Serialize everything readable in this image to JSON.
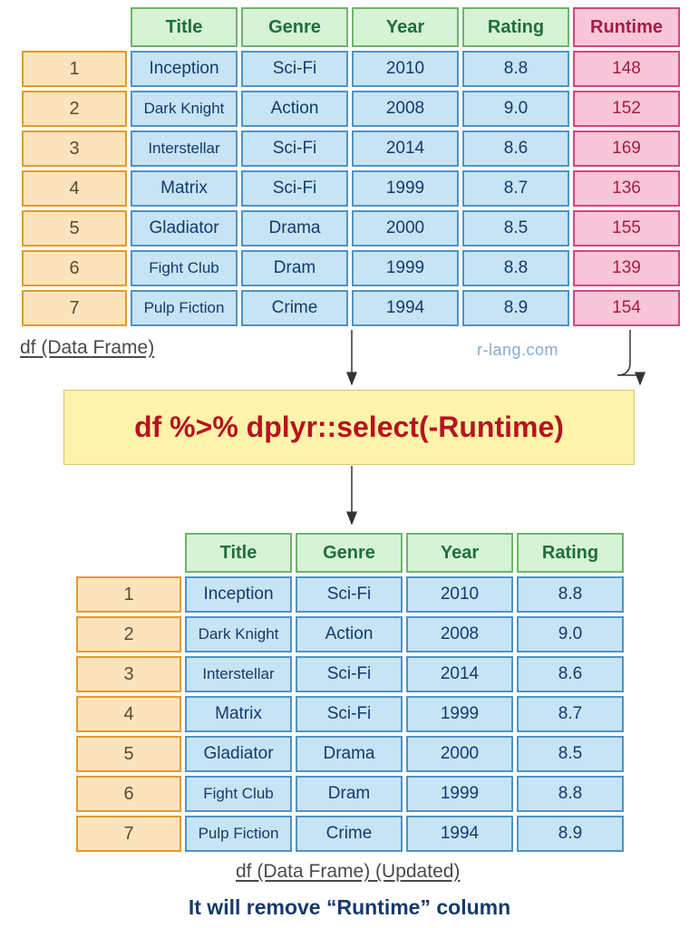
{
  "columns": [
    "Title",
    "Genre",
    "Year",
    "Rating",
    "Runtime"
  ],
  "highlight_column": "Runtime",
  "rows": [
    {
      "idx": "1",
      "Title": "Inception",
      "Genre": "Sci-Fi",
      "Year": "2010",
      "Rating": "8.8",
      "Runtime": "148"
    },
    {
      "idx": "2",
      "Title": "Dark Knight",
      "Genre": "Action",
      "Year": "2008",
      "Rating": "9.0",
      "Runtime": "152"
    },
    {
      "idx": "3",
      "Title": "Interstellar",
      "Genre": "Sci-Fi",
      "Year": "2014",
      "Rating": "8.6",
      "Runtime": "169"
    },
    {
      "idx": "4",
      "Title": "Matrix",
      "Genre": "Sci-Fi",
      "Year": "1999",
      "Rating": "8.7",
      "Runtime": "136"
    },
    {
      "idx": "5",
      "Title": "Gladiator",
      "Genre": "Drama",
      "Year": "2000",
      "Rating": "8.5",
      "Runtime": "155"
    },
    {
      "idx": "6",
      "Title": "Fight Club",
      "Genre": "Dram",
      "Year": "1999",
      "Rating": "8.8",
      "Runtime": "139"
    },
    {
      "idx": "7",
      "Title": "Pulp Fiction",
      "Genre": "Crime",
      "Year": "1994",
      "Rating": "8.9",
      "Runtime": "154"
    }
  ],
  "columns_after": [
    "Title",
    "Genre",
    "Year",
    "Rating"
  ],
  "caption_top": "df (Data Frame)",
  "caption_bottom": "df (Data Frame) (Updated)",
  "watermark": "r-lang.com",
  "code": "df %>% dplyr::select(-Runtime)",
  "bottom_note": "It will remove “Runtime” column"
}
